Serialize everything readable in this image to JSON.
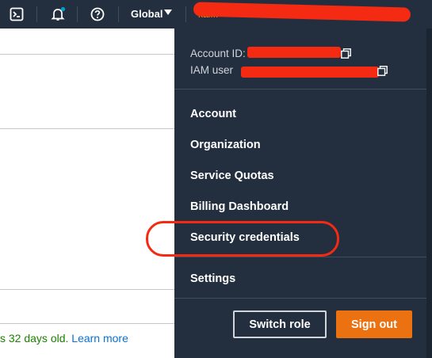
{
  "topbar": {
    "region_label": "Global",
    "account_label": "kai..."
  },
  "dropdown": {
    "account_id_label": "Account ID:",
    "iam_user_label": "IAM user",
    "menu": {
      "account": "Account",
      "organization": "Organization",
      "service_quotas": "Service Quotas",
      "billing_dashboard": "Billing Dashboard",
      "security_credentials": "Security credentials",
      "settings": "Settings"
    },
    "switch_role": "Switch role",
    "sign_out": "Sign out"
  },
  "content": {
    "notice_text": "s 32 days old.",
    "notice_link": "Learn more"
  },
  "colors": {
    "nav_bg": "#232f3e",
    "accent_orange": "#ec7211",
    "notification_dot": "#00a1c9",
    "annotation_red": "#f52a12"
  }
}
